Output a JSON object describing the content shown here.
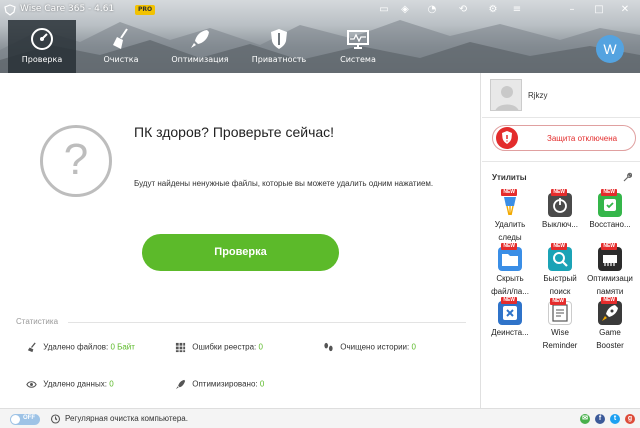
{
  "app": {
    "title": "Wise Care 365 - 4.61",
    "badge": "PRO",
    "user_initial": "W"
  },
  "titlebar_icons": [
    "screen-icon",
    "theme-icon",
    "update-icon",
    "restore-icon",
    "settings-icon",
    "menu-icon",
    "minimize-icon",
    "maximize-icon",
    "close-icon"
  ],
  "nav": [
    {
      "label": "Проверка",
      "icon": "speedometer-icon",
      "active": true
    },
    {
      "label": "Очистка",
      "icon": "broom-icon",
      "active": false
    },
    {
      "label": "Оптимизация",
      "icon": "rocket-icon",
      "active": false
    },
    {
      "label": "Приватность",
      "icon": "shield-icon",
      "active": false
    },
    {
      "label": "Система",
      "icon": "monitor-icon",
      "active": false
    }
  ],
  "main": {
    "headline": "ПК здоров? Проверьте сейчас!",
    "subtext": "Будут найдены ненужные файлы, которые вы можете удалить одним нажатием.",
    "button": "Проверка",
    "question_mark": "?"
  },
  "stats": {
    "title": "Статистика",
    "items": [
      {
        "label": "Удалено файлов:",
        "value": "0 Байт",
        "icon": "broom-icon"
      },
      {
        "label": "Ошибки реестра:",
        "value": "0",
        "icon": "grid-icon"
      },
      {
        "label": "Очищено истории:",
        "value": "0",
        "icon": "footprints-icon"
      },
      {
        "label": "Удалено данных:",
        "value": "0",
        "icon": "eye-icon"
      },
      {
        "label": "Оптимизировано:",
        "value": "0",
        "icon": "rocket-icon"
      }
    ]
  },
  "side": {
    "username": "Rjkzy",
    "protection": "Защита отключена",
    "utilities_title": "Утилиты",
    "new_badge": "NEW",
    "tools": [
      {
        "label1": "Удалить",
        "label2": "следы",
        "icon": "trash-icon",
        "color": "#ffffff"
      },
      {
        "label1": "Выключ...",
        "label2": "",
        "icon": "power-icon",
        "color": "#4a4a4a"
      },
      {
        "label1": "Восстано...",
        "label2": "",
        "icon": "restore-icon",
        "color": "#35b64a"
      },
      {
        "label1": "Скрыть",
        "label2": "файл/па...",
        "icon": "folder-icon",
        "color": "#3a8ee6"
      },
      {
        "label1": "Быстрый",
        "label2": "поиск",
        "icon": "search-icon",
        "color": "#1ba3b6"
      },
      {
        "label1": "Оптимизаци",
        "label2": "памяти",
        "icon": "memory-icon",
        "color": "#2c2c2c"
      },
      {
        "label1": "Деинста...",
        "label2": "",
        "icon": "uninstall-icon",
        "color": "#2f73c9"
      },
      {
        "label1": "Wise",
        "label2": "Reminder",
        "icon": "reminder-icon",
        "color": "#ffffff"
      },
      {
        "label1": "Game",
        "label2": "Booster",
        "icon": "game-icon",
        "color": "#3a3a3a"
      }
    ]
  },
  "bottom": {
    "toggle": "OFF",
    "text": "Регулярная очистка компьютера.",
    "social": [
      {
        "icon": "message-icon",
        "glyph": "✉",
        "color": "#47b04b"
      },
      {
        "icon": "facebook-icon",
        "glyph": "f",
        "color": "#3b5998"
      },
      {
        "icon": "twitter-icon",
        "glyph": "t",
        "color": "#1da1f2"
      },
      {
        "icon": "googleplus-icon",
        "glyph": "g",
        "color": "#dd4b39"
      }
    ]
  }
}
